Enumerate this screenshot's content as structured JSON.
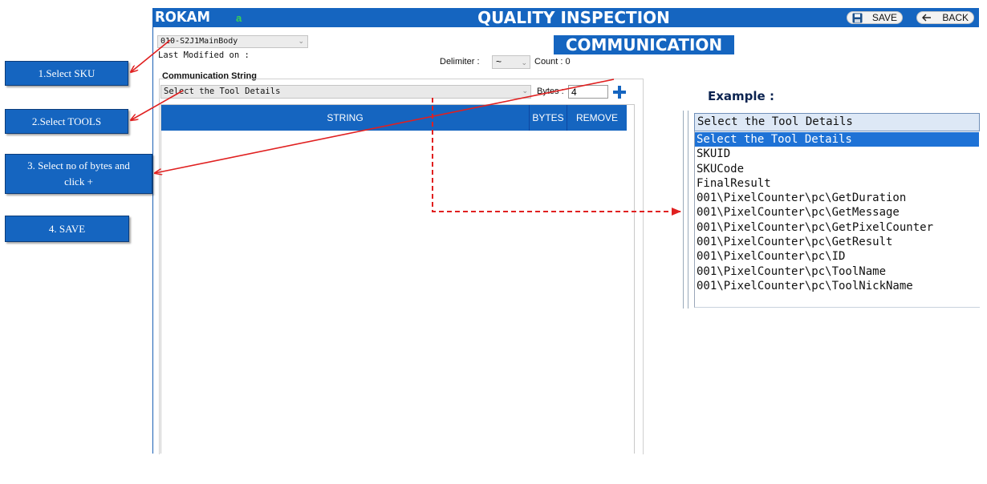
{
  "header": {
    "brand": "ROKAM",
    "user_initial": "a",
    "title": "QUALITY INSPECTION",
    "save_label": "SAVE",
    "back_label": "BACK"
  },
  "form": {
    "sku_value": "010-S2J1MainBody",
    "last_modified_label": "Last Modified on :",
    "section_title": "COMMUNICATION",
    "delimiter_label": "Delimiter :",
    "delimiter_value": "~",
    "count_label": "Count : 0",
    "comm_string_label": "Communication String",
    "tool_select_value": "Select the Tool Details",
    "bytes_label": "Bytes :",
    "bytes_value": "4"
  },
  "grid": {
    "columns": [
      "STRING",
      "BYTES",
      "REMOVE"
    ]
  },
  "callouts": [
    "1.Select  SKU",
    "2.Select TOOLS",
    "3. Select no of bytes and click +",
    "4. SAVE"
  ],
  "example": {
    "title": "Example :",
    "header": "Select the Tool Details",
    "items": [
      "Select the Tool Details",
      "SKUID",
      "SKUCode",
      "FinalResult",
      "001\\PixelCounter\\pc\\GetDuration",
      "001\\PixelCounter\\pc\\GetMessage",
      "001\\PixelCounter\\pc\\GetPixelCounter",
      "001\\PixelCounter\\pc\\GetResult",
      "001\\PixelCounter\\pc\\ID",
      "001\\PixelCounter\\pc\\ToolName",
      "001\\PixelCounter\\pc\\ToolNickName"
    ],
    "selected_index": 0
  },
  "colors": {
    "header_blue": "#1565c0",
    "selection_blue": "#1e72d6",
    "arrow_red": "#e02020",
    "user_green": "#39d353"
  },
  "icons": {
    "save": "floppy-disk-icon",
    "back": "left-arrow-icon",
    "add": "plus-icon",
    "dropdown": "chevron-down-icon"
  }
}
